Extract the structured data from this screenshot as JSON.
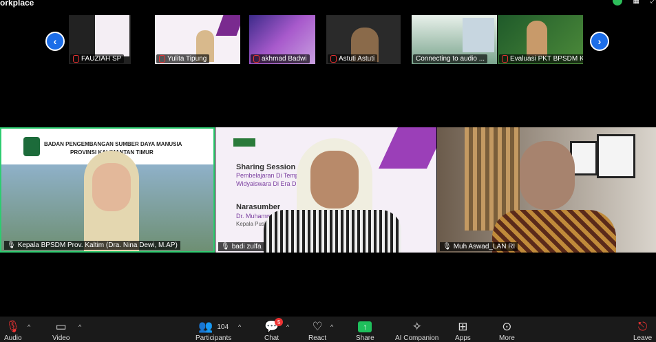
{
  "window": {
    "title": "orkplace"
  },
  "strip": {
    "participants": [
      {
        "name": "FAUZIAH SP"
      },
      {
        "name": "Yulita Tipung"
      },
      {
        "name": "akhmad Badwi"
      },
      {
        "name": "Astuti Astuti"
      },
      {
        "name": "Connecting to audio ..."
      },
      {
        "name": "Evaluasi PKT BPSDM K..."
      }
    ],
    "prev_icon": "‹",
    "next_icon": "›"
  },
  "slide": {
    "heading": "Sharing Session",
    "line1": "Pembelajaran Di Temp",
    "line2": "Widyaiswara Di Era Digi",
    "narasumber": "Narasumber",
    "speaker": "Dr. Muhammad A",
    "speaker_role": "Kepala Pusiat"
  },
  "banner": {
    "line1": "BADAN PENGEMBANGAN SUMBER DAYA MANUSIA",
    "line2": "PROVINSI KALIMANTAN TIMUR"
  },
  "tiles": [
    {
      "name": "Kepala BPSDM Prov. Kaltim (Dra. Nina Dewi, M.AP)"
    },
    {
      "name": "badi zulfa"
    },
    {
      "name": "Muh Aswad_LAN RI"
    }
  ],
  "toolbar": {
    "audio": "Audio",
    "video": "Video",
    "participants": "Participants",
    "participants_count": "104",
    "chat": "Chat",
    "chat_badge": "5",
    "react": "React",
    "share": "Share",
    "ai": "AI Companion",
    "apps": "Apps",
    "more": "More",
    "leave": "Leave"
  },
  "colors": {
    "accent": "#1d6ee8",
    "active_border": "#2ecc71",
    "share": "#1fbf5c",
    "leave": "#e33535"
  }
}
